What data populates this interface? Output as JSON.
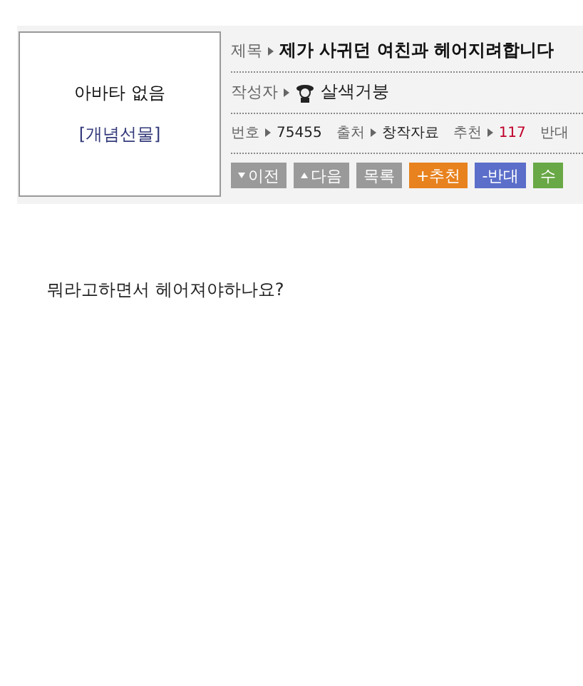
{
  "avatar": {
    "text": "아바타 없음",
    "link": "[개념선물]"
  },
  "title": {
    "label": "제목",
    "value": "제가 사귀던 여친과 헤어지려합니다"
  },
  "writer": {
    "label": "작성자",
    "name": "살색거붕"
  },
  "info": [
    {
      "label": "번호",
      "value": "75455",
      "kind": "plain"
    },
    {
      "label": "출처",
      "value": "창작자료",
      "kind": "plain"
    },
    {
      "label": "추천",
      "value": "117",
      "kind": "count"
    },
    {
      "label": "반대"
    }
  ],
  "buttons": [
    {
      "label": "이전",
      "kind": "prev"
    },
    {
      "label": "다음",
      "kind": "next"
    },
    {
      "label": "목록",
      "kind": "list"
    },
    {
      "label": "+추천",
      "kind": "upvote"
    },
    {
      "label": "-반대",
      "kind": "downvote"
    },
    {
      "label": "수",
      "kind": "edit"
    }
  ],
  "body": "뭐라고하면서 헤어져야하나요?"
}
